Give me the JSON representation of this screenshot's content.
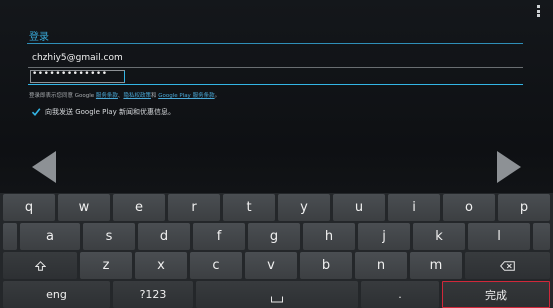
{
  "header": {
    "title": "登录"
  },
  "form": {
    "email_value": "chzhiy5@gmail.com",
    "password_value": "•••••••••••••"
  },
  "terms": {
    "prefix": "登录即表示您同意 Google ",
    "link_tos": "服务条款",
    "sep1": "、",
    "link_privacy": "隐私权政策",
    "sep2": "和 ",
    "link_play": "Google Play 服务条款",
    "suffix": "。"
  },
  "checkbox": {
    "label": "向我发送 Google Play 新闻和优惠信息。",
    "checked": true
  },
  "keyboard": {
    "row1": [
      "q",
      "w",
      "e",
      "r",
      "t",
      "y",
      "u",
      "i",
      "o",
      "p"
    ],
    "row2": [
      "a",
      "s",
      "d",
      "f",
      "g",
      "h",
      "j",
      "k",
      "l"
    ],
    "row3": [
      "z",
      "x",
      "c",
      "v",
      "b",
      "n",
      "m"
    ],
    "lang_key": "eng",
    "symbols_key": "?123",
    "period_key": ".",
    "done_key": "完成"
  },
  "icons": {
    "overflow": "overflow-menu-icon",
    "shift": "shift-icon",
    "delete": "delete-icon",
    "space": "space-icon",
    "prev": "back-arrow-icon",
    "next": "next-arrow-icon",
    "check": "check-icon"
  },
  "colors": {
    "accent": "#33b5e5",
    "done_border": "#d0283a"
  }
}
